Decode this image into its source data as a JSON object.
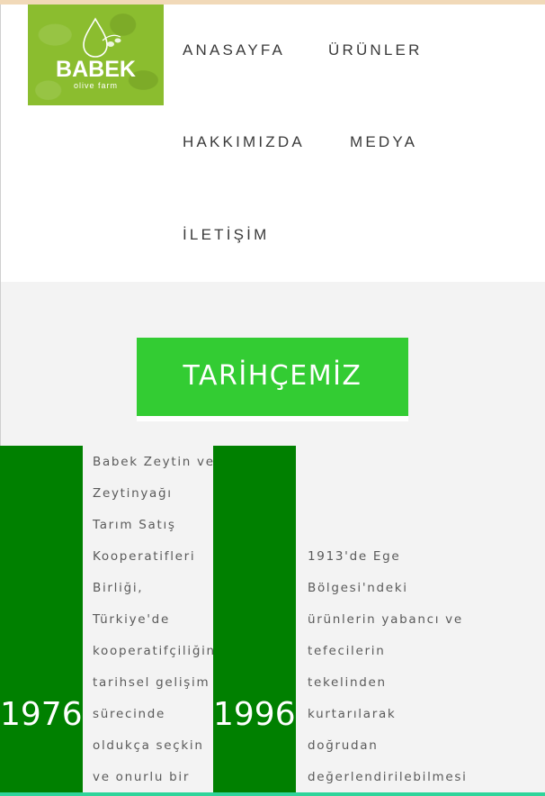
{
  "logo": {
    "brand": "BABEK",
    "sub": "olive farm",
    "icon": "olive-drop-icon"
  },
  "nav": {
    "items": [
      "ANASAYFA",
      "ÜRÜNLER",
      "HAKKIMIZDA",
      "MEDYA",
      "İLETİŞİM"
    ]
  },
  "section": {
    "title": "TARİHÇEMİZ"
  },
  "timeline": [
    {
      "year": "1976",
      "lines": [
        "Babek Zeytin ve",
        "Zeytinyağı",
        "Tarım Satış",
        "Kooperatifleri",
        "Birliği,",
        "Türkiye'de",
        "kooperatifçiliğin",
        "tarihsel gelişim",
        "sürecinde",
        "oldukça seçkin",
        "ve onurlu bir"
      ]
    },
    {
      "year": "1996",
      "lines": [
        "1913'de Ege",
        "Bölgesi'ndeki",
        "ürünlerin yabancı ve",
        "tefecilerin",
        "tekelinden",
        "kurtarılarak",
        "doğrudan",
        "değerlendirilebilmesi"
      ]
    }
  ],
  "colors": {
    "logo_bg": "#8bbd2f",
    "title_bg": "#33cc33",
    "year_bg": "#008000",
    "accent_bottom": "#2fd49a"
  }
}
